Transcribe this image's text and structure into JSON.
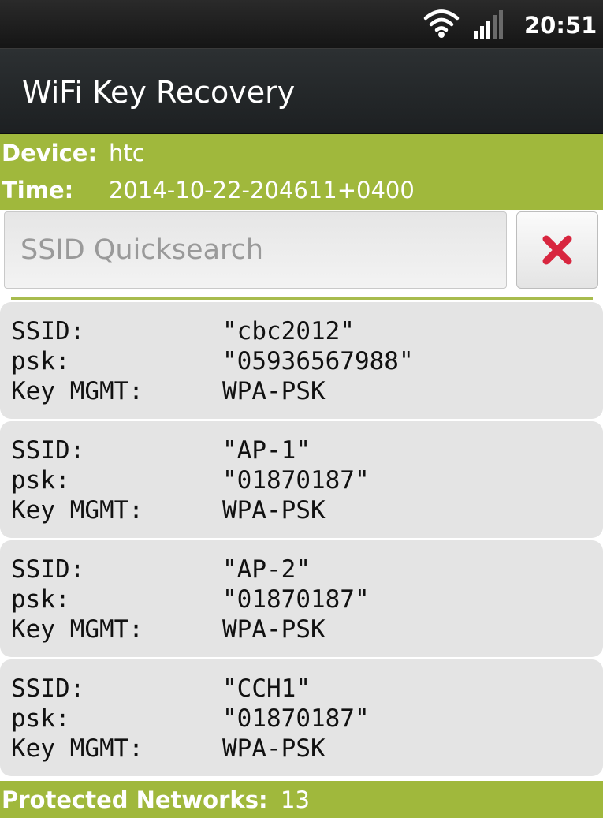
{
  "status_bar": {
    "time": "20:51",
    "icons": [
      "wifi-icon",
      "signal-icon"
    ]
  },
  "app": {
    "title": "WiFi Key Recovery"
  },
  "info": {
    "device_label": "Device:",
    "device_value": "htc",
    "time_label": "Time:",
    "time_value": "2014-10-22-204611+0400"
  },
  "search": {
    "placeholder": "SSID Quicksearch",
    "value": "",
    "clear_icon": "close-icon"
  },
  "networks": [
    {
      "ssid_label": "SSID:",
      "ssid": "\"cbc2012\"",
      "psk_label": "psk:",
      "psk": "\"05936567988\"",
      "mgmt_label": "Key MGMT:",
      "mgmt": "WPA-PSK"
    },
    {
      "ssid_label": "SSID:",
      "ssid": "\"AP-1\"",
      "psk_label": "psk:",
      "psk": "\"01870187\"",
      "mgmt_label": "Key MGMT:",
      "mgmt": "WPA-PSK"
    },
    {
      "ssid_label": "SSID:",
      "ssid": "\"AP-2\"",
      "psk_label": "psk:",
      "psk": "\"01870187\"",
      "mgmt_label": "Key MGMT:",
      "mgmt": "WPA-PSK"
    },
    {
      "ssid_label": "SSID:",
      "ssid": "\"CCH1\"",
      "psk_label": "psk:",
      "psk": "\"01870187\"",
      "mgmt_label": "Key MGMT:",
      "mgmt": "WPA-PSK"
    }
  ],
  "footer": {
    "label": "Protected Networks:",
    "count": "13"
  },
  "colors": {
    "accent_green": "#a0b83c",
    "clear_red": "#d8263f",
    "title_bar": "#25292b"
  }
}
